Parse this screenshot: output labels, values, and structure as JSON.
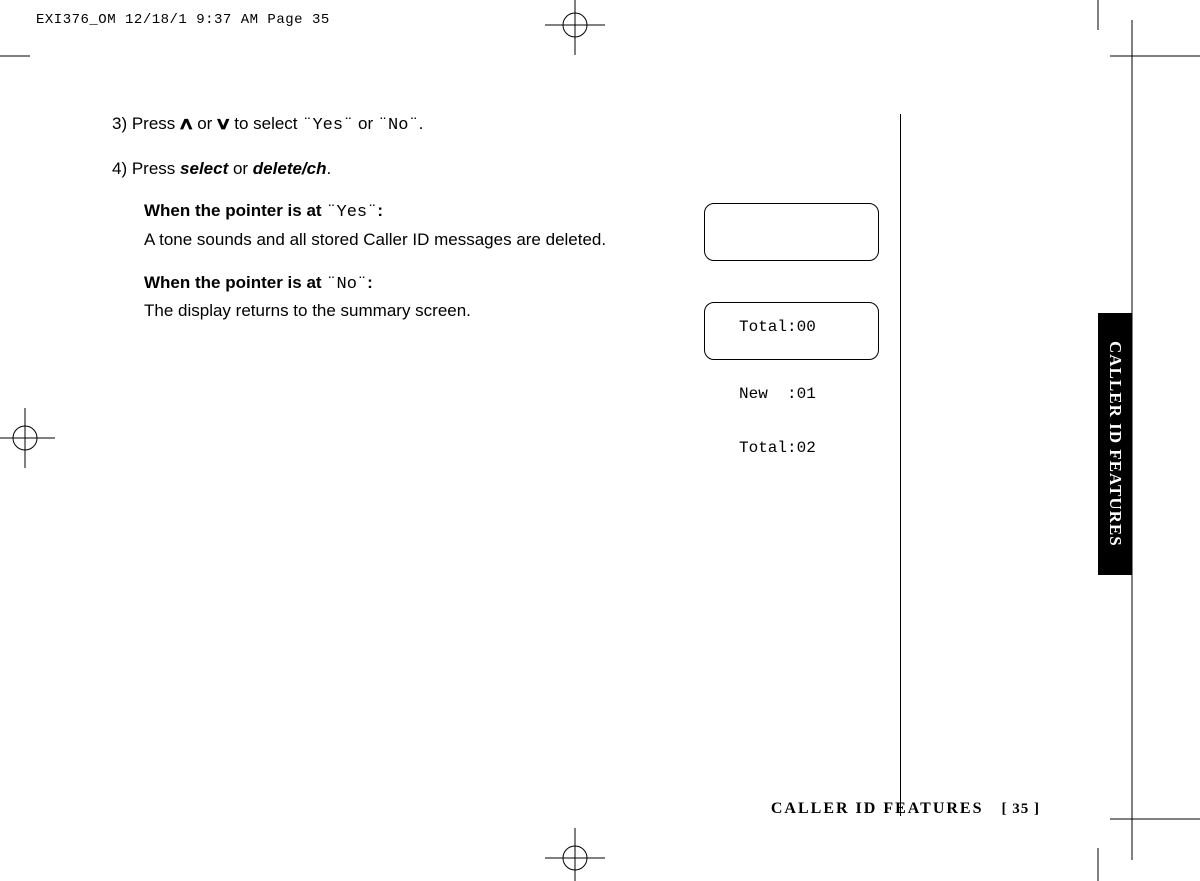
{
  "header": {
    "filestamp": "EXI376_OM  12/18/1 9:37 AM  Page 35"
  },
  "body": {
    "step3_pre": "3) Press ",
    "step3_mid": " or ",
    "step3_post": " to select ",
    "yes": "¨Yes¨",
    "no": "¨No¨",
    "step3_or": " or ",
    "step3_end": ".",
    "step4_pre": "4) Press ",
    "select": "select",
    "step4_mid": " or ",
    "deletech": "delete/ch",
    "step4_end": ".",
    "yes_heading_pre": "When the pointer is at ",
    "yes_heading_post": ":",
    "yes_text": "A tone sounds and all stored Caller ID messages are deleted.",
    "no_heading_pre": "When the pointer is at ",
    "no_heading_post": ":",
    "no_text": "The display returns to the summary screen."
  },
  "lcd1": {
    "line1": "",
    "line2": "Total:00"
  },
  "lcd2": {
    "line1": "New  :01",
    "line2": "Total:02"
  },
  "sidetab": "CALLER ID FEATURES",
  "footer": {
    "section": "CALLER ID FEATURES",
    "page": "[ 35 ]"
  }
}
